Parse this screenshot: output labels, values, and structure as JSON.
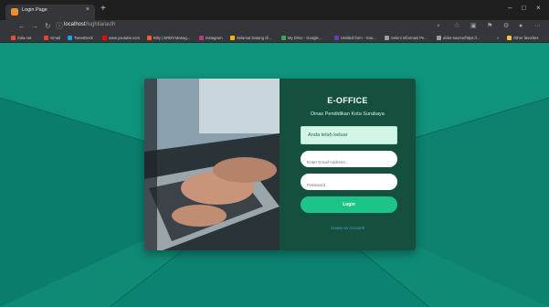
{
  "browser": {
    "tab_title": "Login Page",
    "tab_close": "×",
    "new_tab": "+",
    "window_controls": [
      "–",
      "□",
      "×"
    ],
    "nav": {
      "back": "←",
      "forward": "→",
      "reload": "↻",
      "info": "ⓘ"
    },
    "url_host": "localhost",
    "url_path": "/lughtia/auth",
    "toolbar_right": [
      "⌕",
      "☆",
      "▣",
      "⚑",
      "⚙",
      "●",
      "⋯"
    ],
    "bookmarks": [
      {
        "label": "Sula.net",
        "color": "#e74c3c"
      },
      {
        "label": "Gmail",
        "color": "#ea4335"
      },
      {
        "label": "TweetDeck",
        "color": "#1da1f2"
      },
      {
        "label": "www.youtube.com",
        "color": "#ff0000"
      },
      {
        "label": "Bitly | ERbhl Manag...",
        "color": "#ee6123"
      },
      {
        "label": "Instagram",
        "color": "#c13584"
      },
      {
        "label": "Selamat Datang di...",
        "color": "#f4b400"
      },
      {
        "label": "My Drive - Google...",
        "color": "#34a853"
      },
      {
        "label": "Untitled form - Goo...",
        "color": "#673ab7"
      },
      {
        "label": "Seleni Informasi Pe...",
        "color": "#9e9e9e"
      },
      {
        "label": "elder-source/https://...",
        "color": "#9e9e9e"
      }
    ],
    "bookmarks_more": "»",
    "other_favorites": "Other favorites"
  },
  "login": {
    "title": "E-OFFICE",
    "subtitle": "Dinas Pendidikan Kota Surabaya",
    "alert": "Anda telah keluar",
    "email_placeholder": "Enter Email Address...",
    "password_placeholder": "Password",
    "login_button": "Login",
    "create_account": "Create an Account!"
  },
  "colors": {
    "page_bg": "#0f8a76",
    "card_form_bg": "#15503f",
    "button_green": "#1cc48a",
    "alert_bg": "#d3f5e5",
    "link_blue": "#4aa6d8"
  }
}
